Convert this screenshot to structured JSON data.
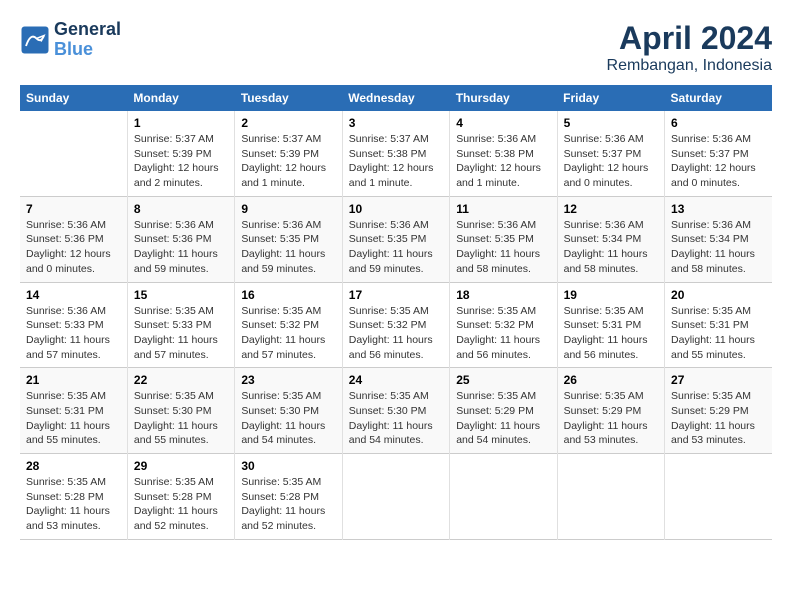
{
  "header": {
    "logo_line1": "General",
    "logo_line2": "Blue",
    "title": "April 2024",
    "subtitle": "Rembangan, Indonesia"
  },
  "columns": [
    "Sunday",
    "Monday",
    "Tuesday",
    "Wednesday",
    "Thursday",
    "Friday",
    "Saturday"
  ],
  "weeks": [
    [
      {
        "day": "",
        "sunrise": "",
        "sunset": "",
        "daylight": ""
      },
      {
        "day": "1",
        "sunrise": "Sunrise: 5:37 AM",
        "sunset": "Sunset: 5:39 PM",
        "daylight": "Daylight: 12 hours and 2 minutes."
      },
      {
        "day": "2",
        "sunrise": "Sunrise: 5:37 AM",
        "sunset": "Sunset: 5:39 PM",
        "daylight": "Daylight: 12 hours and 1 minute."
      },
      {
        "day": "3",
        "sunrise": "Sunrise: 5:37 AM",
        "sunset": "Sunset: 5:38 PM",
        "daylight": "Daylight: 12 hours and 1 minute."
      },
      {
        "day": "4",
        "sunrise": "Sunrise: 5:36 AM",
        "sunset": "Sunset: 5:38 PM",
        "daylight": "Daylight: 12 hours and 1 minute."
      },
      {
        "day": "5",
        "sunrise": "Sunrise: 5:36 AM",
        "sunset": "Sunset: 5:37 PM",
        "daylight": "Daylight: 12 hours and 0 minutes."
      },
      {
        "day": "6",
        "sunrise": "Sunrise: 5:36 AM",
        "sunset": "Sunset: 5:37 PM",
        "daylight": "Daylight: 12 hours and 0 minutes."
      }
    ],
    [
      {
        "day": "7",
        "sunrise": "Sunrise: 5:36 AM",
        "sunset": "Sunset: 5:36 PM",
        "daylight": "Daylight: 12 hours and 0 minutes."
      },
      {
        "day": "8",
        "sunrise": "Sunrise: 5:36 AM",
        "sunset": "Sunset: 5:36 PM",
        "daylight": "Daylight: 11 hours and 59 minutes."
      },
      {
        "day": "9",
        "sunrise": "Sunrise: 5:36 AM",
        "sunset": "Sunset: 5:35 PM",
        "daylight": "Daylight: 11 hours and 59 minutes."
      },
      {
        "day": "10",
        "sunrise": "Sunrise: 5:36 AM",
        "sunset": "Sunset: 5:35 PM",
        "daylight": "Daylight: 11 hours and 59 minutes."
      },
      {
        "day": "11",
        "sunrise": "Sunrise: 5:36 AM",
        "sunset": "Sunset: 5:35 PM",
        "daylight": "Daylight: 11 hours and 58 minutes."
      },
      {
        "day": "12",
        "sunrise": "Sunrise: 5:36 AM",
        "sunset": "Sunset: 5:34 PM",
        "daylight": "Daylight: 11 hours and 58 minutes."
      },
      {
        "day": "13",
        "sunrise": "Sunrise: 5:36 AM",
        "sunset": "Sunset: 5:34 PM",
        "daylight": "Daylight: 11 hours and 58 minutes."
      }
    ],
    [
      {
        "day": "14",
        "sunrise": "Sunrise: 5:36 AM",
        "sunset": "Sunset: 5:33 PM",
        "daylight": "Daylight: 11 hours and 57 minutes."
      },
      {
        "day": "15",
        "sunrise": "Sunrise: 5:35 AM",
        "sunset": "Sunset: 5:33 PM",
        "daylight": "Daylight: 11 hours and 57 minutes."
      },
      {
        "day": "16",
        "sunrise": "Sunrise: 5:35 AM",
        "sunset": "Sunset: 5:32 PM",
        "daylight": "Daylight: 11 hours and 57 minutes."
      },
      {
        "day": "17",
        "sunrise": "Sunrise: 5:35 AM",
        "sunset": "Sunset: 5:32 PM",
        "daylight": "Daylight: 11 hours and 56 minutes."
      },
      {
        "day": "18",
        "sunrise": "Sunrise: 5:35 AM",
        "sunset": "Sunset: 5:32 PM",
        "daylight": "Daylight: 11 hours and 56 minutes."
      },
      {
        "day": "19",
        "sunrise": "Sunrise: 5:35 AM",
        "sunset": "Sunset: 5:31 PM",
        "daylight": "Daylight: 11 hours and 56 minutes."
      },
      {
        "day": "20",
        "sunrise": "Sunrise: 5:35 AM",
        "sunset": "Sunset: 5:31 PM",
        "daylight": "Daylight: 11 hours and 55 minutes."
      }
    ],
    [
      {
        "day": "21",
        "sunrise": "Sunrise: 5:35 AM",
        "sunset": "Sunset: 5:31 PM",
        "daylight": "Daylight: 11 hours and 55 minutes."
      },
      {
        "day": "22",
        "sunrise": "Sunrise: 5:35 AM",
        "sunset": "Sunset: 5:30 PM",
        "daylight": "Daylight: 11 hours and 55 minutes."
      },
      {
        "day": "23",
        "sunrise": "Sunrise: 5:35 AM",
        "sunset": "Sunset: 5:30 PM",
        "daylight": "Daylight: 11 hours and 54 minutes."
      },
      {
        "day": "24",
        "sunrise": "Sunrise: 5:35 AM",
        "sunset": "Sunset: 5:30 PM",
        "daylight": "Daylight: 11 hours and 54 minutes."
      },
      {
        "day": "25",
        "sunrise": "Sunrise: 5:35 AM",
        "sunset": "Sunset: 5:29 PM",
        "daylight": "Daylight: 11 hours and 54 minutes."
      },
      {
        "day": "26",
        "sunrise": "Sunrise: 5:35 AM",
        "sunset": "Sunset: 5:29 PM",
        "daylight": "Daylight: 11 hours and 53 minutes."
      },
      {
        "day": "27",
        "sunrise": "Sunrise: 5:35 AM",
        "sunset": "Sunset: 5:29 PM",
        "daylight": "Daylight: 11 hours and 53 minutes."
      }
    ],
    [
      {
        "day": "28",
        "sunrise": "Sunrise: 5:35 AM",
        "sunset": "Sunset: 5:28 PM",
        "daylight": "Daylight: 11 hours and 53 minutes."
      },
      {
        "day": "29",
        "sunrise": "Sunrise: 5:35 AM",
        "sunset": "Sunset: 5:28 PM",
        "daylight": "Daylight: 11 hours and 52 minutes."
      },
      {
        "day": "30",
        "sunrise": "Sunrise: 5:35 AM",
        "sunset": "Sunset: 5:28 PM",
        "daylight": "Daylight: 11 hours and 52 minutes."
      },
      {
        "day": "",
        "sunrise": "",
        "sunset": "",
        "daylight": ""
      },
      {
        "day": "",
        "sunrise": "",
        "sunset": "",
        "daylight": ""
      },
      {
        "day": "",
        "sunrise": "",
        "sunset": "",
        "daylight": ""
      },
      {
        "day": "",
        "sunrise": "",
        "sunset": "",
        "daylight": ""
      }
    ]
  ]
}
